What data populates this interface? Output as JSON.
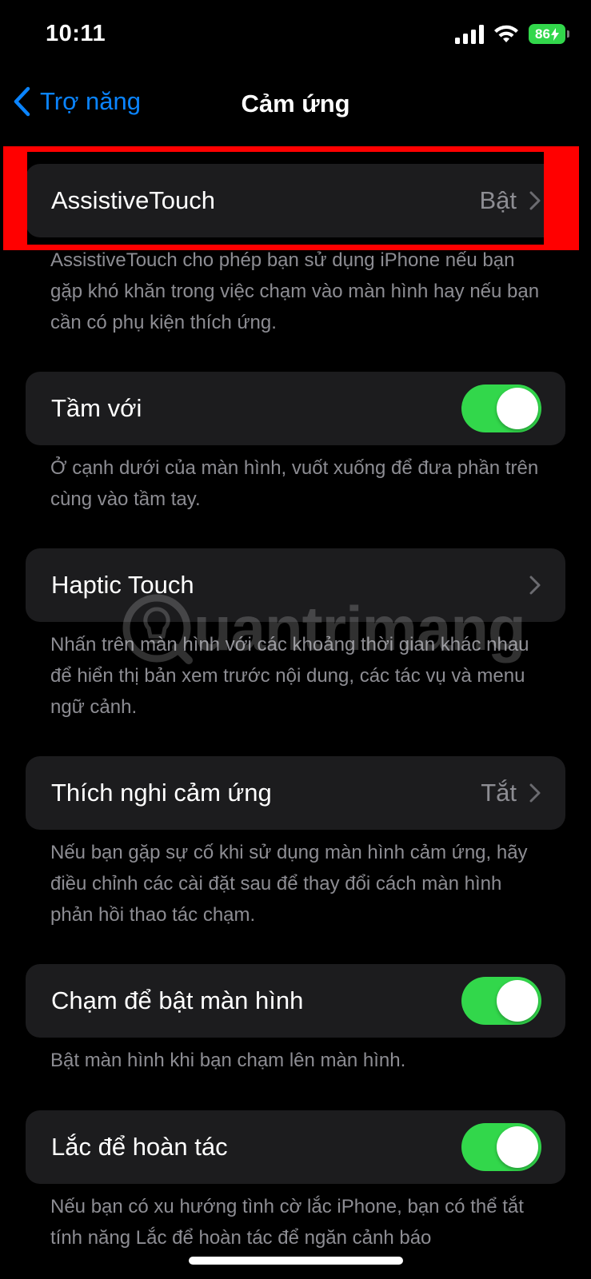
{
  "status_bar": {
    "time": "10:11",
    "battery": "86"
  },
  "nav": {
    "back_label": "Trợ năng",
    "title": "Cảm ứng"
  },
  "rows": [
    {
      "label": "AssistiveTouch",
      "value": "Bật",
      "footer": "AssistiveTouch cho phép bạn sử dụng iPhone nếu bạn gặp khó khăn trong việc chạm vào màn hình hay nếu bạn cần có phụ kiện thích ứng."
    },
    {
      "label": "Tầm với",
      "toggle_on": true,
      "footer": "Ở cạnh dưới của màn hình, vuốt xuống để đưa phần trên cùng vào tầm tay."
    },
    {
      "label": "Haptic Touch",
      "footer": "Nhấn trên màn hình với các khoảng thời gian khác nhau để hiển thị bản xem trước nội dung, các tác vụ và menu ngữ cảnh."
    },
    {
      "label": "Thích nghi cảm ứng",
      "value": "Tắt",
      "footer": "Nếu bạn gặp sự cố khi sử dụng màn hình cảm ứng, hãy điều chỉnh các cài đặt sau để thay đổi cách màn hình phản hồi thao tác chạm."
    },
    {
      "label": "Chạm để bật màn hình",
      "toggle_on": true,
      "footer": "Bật màn hình khi bạn chạm lên màn hình."
    },
    {
      "label": "Lắc để hoàn tác",
      "toggle_on": true,
      "footer": "Nếu bạn có xu hướng tình cờ lắc iPhone, bạn có thể tắt tính năng Lắc để hoàn tác để ngăn cảnh báo"
    }
  ],
  "watermark": "uantrimang",
  "colors": {
    "background": "#000000",
    "cell": "#1c1c1e",
    "accent": "#0a84ff",
    "toggle_on": "#32d74b",
    "secondary_text": "#8d8d93",
    "highlight": "#ff0000"
  },
  "icons": {
    "back": "chevron-left-icon",
    "disclosure": "chevron-right-icon",
    "signal": "cellular-signal-icon",
    "wifi": "wifi-icon",
    "battery": "battery-charging-icon",
    "watermark_logo": "lightbulb-icon"
  }
}
